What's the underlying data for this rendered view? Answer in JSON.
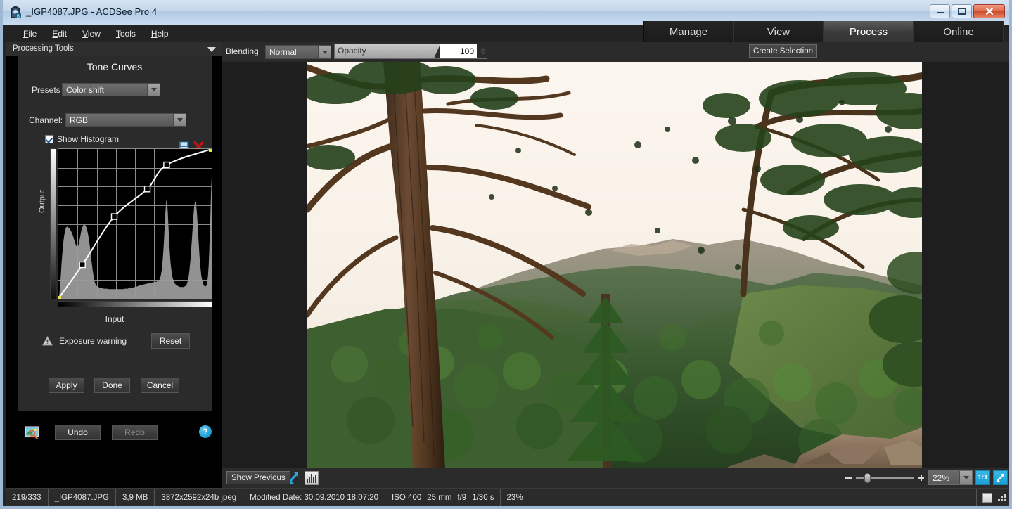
{
  "window": {
    "title": "_IGP4087.JPG - ACDSee Pro 4",
    "icon": "app-icon",
    "minimize_label": "minimize-icon",
    "maximize_label": "restore-icon",
    "close_label": "close-icon"
  },
  "menubar": {
    "items": [
      {
        "label": "File",
        "accel": "F"
      },
      {
        "label": "Edit",
        "accel": "E"
      },
      {
        "label": "View",
        "accel": "V"
      },
      {
        "label": "Tools",
        "accel": "T"
      },
      {
        "label": "Help",
        "accel": "H"
      }
    ]
  },
  "mode_tabs": [
    {
      "label": "Manage",
      "active": false
    },
    {
      "label": "View",
      "active": false
    },
    {
      "label": "Process",
      "active": true
    },
    {
      "label": "Online",
      "active": false
    }
  ],
  "left_panel": {
    "header_title": "Processing Tools",
    "tool_title": "Tone Curves",
    "presets_label": "Presets",
    "presets_value": "Color shift",
    "save_preset_icon": "floppy-save-icon",
    "delete_preset_icon": "red-x-delete-icon",
    "channel_label": "Channel:",
    "channel_value": "RGB",
    "show_histogram_label": "Show Histogram",
    "show_histogram_checked": true,
    "axis_y_label": "Output",
    "axis_x_label": "Input",
    "exposure_warning_label": "Exposure warning",
    "exposure_warning_icon": "warning-triangle-icon",
    "reset_label": "Reset",
    "apply_label": "Apply",
    "done_label": "Done",
    "cancel_label": "Cancel",
    "undo_label": "Undo",
    "redo_label": "Redo",
    "redo_disabled": true,
    "preview_icon": "image-preview-icon",
    "help_icon": "help-question-icon",
    "help_glyph": "?"
  },
  "chart_data": {
    "type": "line",
    "title": "Tone Curves",
    "xlabel": "Input",
    "ylabel": "Output",
    "xlim": [
      0,
      255
    ],
    "ylim": [
      0,
      255
    ],
    "grid": true,
    "grid_cols": 8,
    "grid_rows": 8,
    "channel": "RGB",
    "curve_points": [
      {
        "input": 0,
        "output": 0,
        "endpoint": true
      },
      {
        "input": 40,
        "output": 58,
        "endpoint": false
      },
      {
        "input": 93,
        "output": 140,
        "endpoint": false
      },
      {
        "input": 148,
        "output": 187,
        "endpoint": false
      },
      {
        "input": 180,
        "output": 228,
        "endpoint": false
      },
      {
        "input": 255,
        "output": 255,
        "endpoint": true
      }
    ],
    "histogram": {
      "label": "Show Histogram",
      "visible": true,
      "bins": [
        2,
        5,
        12,
        26,
        44,
        62,
        78,
        92,
        104,
        114,
        122,
        128,
        132,
        134,
        135,
        135,
        134,
        133,
        132,
        130,
        128,
        126,
        124,
        121,
        118,
        114,
        110,
        106,
        103,
        100,
        98,
        97,
        98,
        101,
        106,
        112,
        118,
        124,
        129,
        133,
        136,
        138,
        139,
        139,
        138,
        136,
        133,
        129,
        124,
        118,
        111,
        103,
        94,
        84,
        74,
        64,
        55,
        47,
        40,
        34,
        30,
        27,
        25,
        24,
        23,
        22,
        22,
        21,
        21,
        21,
        20,
        20,
        20,
        20,
        19,
        19,
        19,
        19,
        19,
        19,
        19,
        18,
        18,
        18,
        18,
        18,
        18,
        18,
        18,
        18,
        18,
        18,
        18,
        18,
        18,
        18,
        18,
        18,
        18,
        18,
        18,
        18,
        18,
        18,
        18,
        18,
        18,
        18,
        19,
        19,
        19,
        19,
        19,
        19,
        19,
        20,
        20,
        20,
        20,
        20,
        21,
        21,
        21,
        21,
        22,
        22,
        22,
        23,
        23,
        23,
        24,
        24,
        24,
        25,
        25,
        25,
        26,
        26,
        26,
        27,
        27,
        27,
        28,
        28,
        28,
        28,
        29,
        29,
        29,
        29,
        30,
        30,
        30,
        30,
        31,
        31,
        31,
        31,
        32,
        32,
        32,
        32,
        33,
        33,
        34,
        35,
        37,
        40,
        45,
        52,
        62,
        75,
        92,
        112,
        135,
        158,
        176,
        185,
        180,
        165,
        142,
        118,
        96,
        78,
        64,
        54,
        46,
        40,
        36,
        33,
        30,
        28,
        27,
        26,
        25,
        24,
        24,
        23,
        23,
        22,
        22,
        22,
        22,
        22,
        22,
        22,
        23,
        23,
        24,
        25,
        27,
        30,
        34,
        40,
        48,
        58,
        70,
        84,
        100,
        118,
        136,
        154,
        168,
        178,
        182,
        180,
        172,
        158,
        140,
        120,
        100,
        82,
        66,
        54,
        44,
        37,
        32,
        28,
        26,
        24,
        23,
        23,
        24,
        27,
        33,
        44,
        62,
        88,
        122,
        162,
        200,
        230
      ]
    }
  },
  "options_bar": {
    "blending_label": "Blending",
    "blending_value": "Normal",
    "opacity_label": "Opacity",
    "opacity_value": "100",
    "create_selection_label": "Create Selection"
  },
  "bottom_bar": {
    "show_previous_label": "Show Previous",
    "fit_icon": "diagonal-arrows-icon",
    "histogram_icon": "histogram-icon",
    "zoom_out_icon": "zoom-minus-icon",
    "zoom_in_icon": "zoom-plus-icon",
    "zoom_value": "22%",
    "actual_size_label": "1:1",
    "fit_image_icon": "fit-to-window-icon"
  },
  "status_bar": {
    "index": "219/333",
    "filename": "_IGP4087.JPG",
    "filesize": "3,9 MB",
    "dimensions": "3872x2592x24b jpeg",
    "modified": "Modified Date: 30.09.2010 18:07:20",
    "iso": "ISO 400",
    "focal": "25 mm",
    "aperture": "f/9",
    "shutter": "1/30 s",
    "zoom": "23%",
    "square_icon": "white-square-icon",
    "dots_icon": "resize-grip-icon"
  },
  "colors": {
    "accent_blue": "#2aa6dc",
    "titlebar": "#c3d6ea",
    "panel_bg": "#2b2b2b",
    "canvas_bg": "#1e1e1e",
    "close_red": "#d04a2c"
  }
}
